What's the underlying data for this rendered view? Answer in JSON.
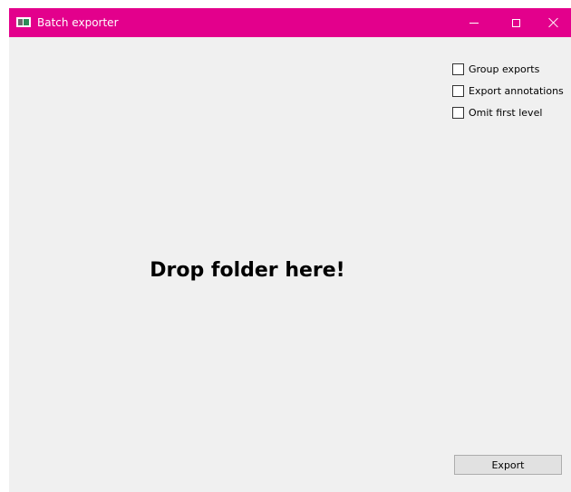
{
  "window": {
    "title": "Batch exporter",
    "accent_color": "#e3008c"
  },
  "titlebar": {
    "app_icon": "app-window-icon",
    "minimize_icon": "minimize-icon",
    "maximize_icon": "maximize-icon",
    "close_icon": "close-icon"
  },
  "options": [
    {
      "label": "Group exports",
      "checked": false
    },
    {
      "label": "Export annotations",
      "checked": false
    },
    {
      "label": "Omit first level",
      "checked": false
    }
  ],
  "drop_zone": {
    "text": "Drop folder here!"
  },
  "export_button": {
    "label": "Export"
  }
}
